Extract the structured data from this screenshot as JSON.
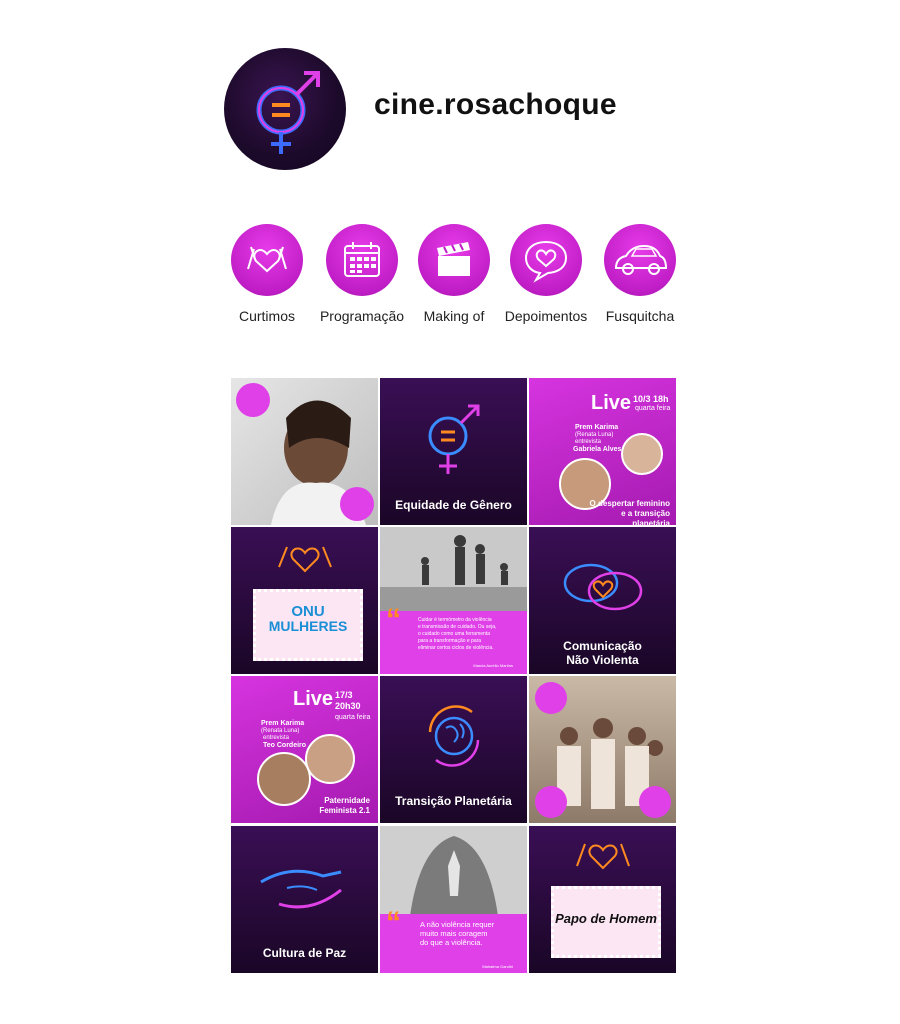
{
  "profile": {
    "username": "cine.rosachoque",
    "avatar_icon": "gender-equality-icon"
  },
  "highlights": [
    {
      "label": "Curtimos",
      "icon": "heart-hands-icon"
    },
    {
      "label": "Programação",
      "icon": "calendar-icon"
    },
    {
      "label": "Making of",
      "icon": "clapperboard-icon"
    },
    {
      "label": "Depoimentos",
      "icon": "speech-heart-icon"
    },
    {
      "label": "Fusquitcha",
      "icon": "beetle-car-icon"
    }
  ],
  "posts": {
    "p2": {
      "caption": "Equidade de Gênero"
    },
    "p3": {
      "live": "Live",
      "date": "10/3 18h",
      "weekday": "quarta feira",
      "host": "Prem Karima",
      "host_note": "(Renata Luna)",
      "verb": "entrevista",
      "guest": "Gabriela Alves",
      "caption": "O despertar feminino\ne a transição planetária"
    },
    "p4": {
      "logo_line1": "ONU",
      "logo_line2": "MULHERES"
    },
    "p5": {
      "quote": "Cuidar é termómetro da violência\ne transmissão de cuidado. Ou seja,\no cuidado como uma ferramenta\npara a transformação e para\neliminar certos ciclos de violência.",
      "author": "Marcia Aurélio Martins"
    },
    "p6": {
      "caption": "Comunicação\nNão Violenta"
    },
    "p7": {
      "live": "Live",
      "date": "17/3\n20h30",
      "weekday": "quarta feira",
      "host": "Prem Karima",
      "host_note": "(Renata Luna)",
      "verb": "entrevista",
      "guest": "Teo Cordeiro",
      "caption": "Paternidade\nFeminista 2.1"
    },
    "p8": {
      "caption": "Transição Planetária"
    },
    "p10": {
      "caption": "Cultura de Paz"
    },
    "p11": {
      "quote": "A não violência requer\nmuito mais coragem\ndo que a violência.",
      "author": "Mahatma Gandhi"
    },
    "p12": {
      "sign": "Papo de Homem"
    }
  },
  "colors": {
    "magenta": "#d634df",
    "dark_purple": "#1a0626",
    "neon_blue": "#3b8cff",
    "neon_orange": "#ff8a1f"
  }
}
